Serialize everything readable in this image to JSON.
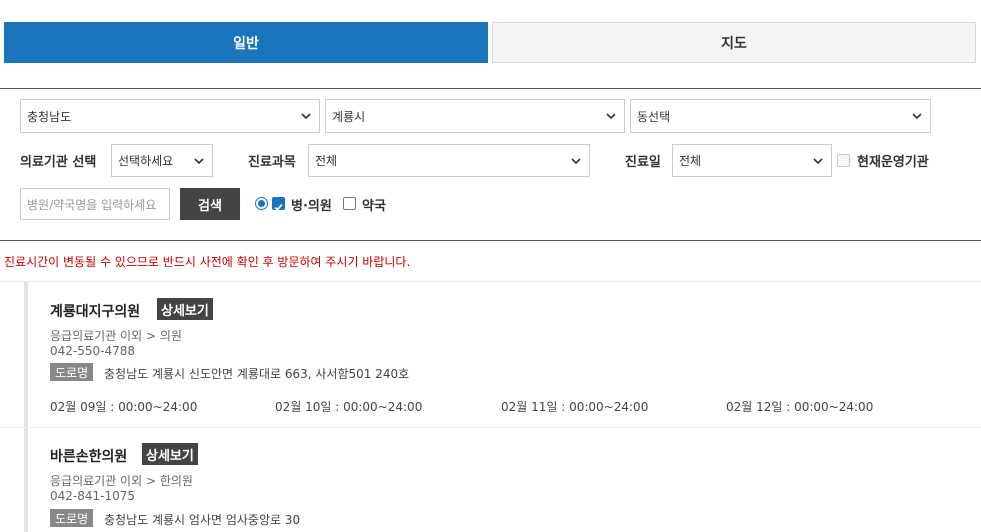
{
  "tabs": {
    "general": "일반",
    "map": "지도"
  },
  "filters": {
    "province": "충청남도",
    "city": "계룡시",
    "town": "동선택",
    "institution_label": "의료기관 선택",
    "institution_value": "선택하세요",
    "department_label": "진료과목",
    "department_value": "전체",
    "day_label": "진료일",
    "day_value": "전체",
    "operating_label": "현재운영기관",
    "search_placeholder": "병원/약국명을 입력하세요",
    "search_button": "검색",
    "type_hospital": "병·의원",
    "type_pharmacy": "약국"
  },
  "notice": "진료시간이 변동될 수 있으므로 반드시 사전에 확인 후 방문하여 주시기 바랍니다.",
  "results": [
    {
      "name": "계룡대지구의원",
      "detail": "상세보기",
      "category": "응급의료기관 이외 > 의원",
      "phone": "042-550-4788",
      "road_label": "도로명",
      "address": "충청남도 계룡시 신도안면 계룡대로 663, 사서함501 240호",
      "hours": [
        "02월 09일 : 00:00~24:00",
        "02월 10일 : 00:00~24:00",
        "02월 11일 : 00:00~24:00",
        "02월 12일 : 00:00~24:00"
      ]
    },
    {
      "name": "바른손한의원",
      "detail": "상세보기",
      "category": "응급의료기관 이외 > 한의원",
      "phone": "042-841-1075",
      "road_label": "도로명",
      "address": "충청남도 계룡시 엄사면 엄사중앙로 30"
    }
  ],
  "colors": {
    "accent": "#1b75bc",
    "notice": "#cc0000",
    "dark_button": "#444444"
  },
  "icons": [
    "chevron-down-icon",
    "radio-icon",
    "checkbox-icon"
  ]
}
